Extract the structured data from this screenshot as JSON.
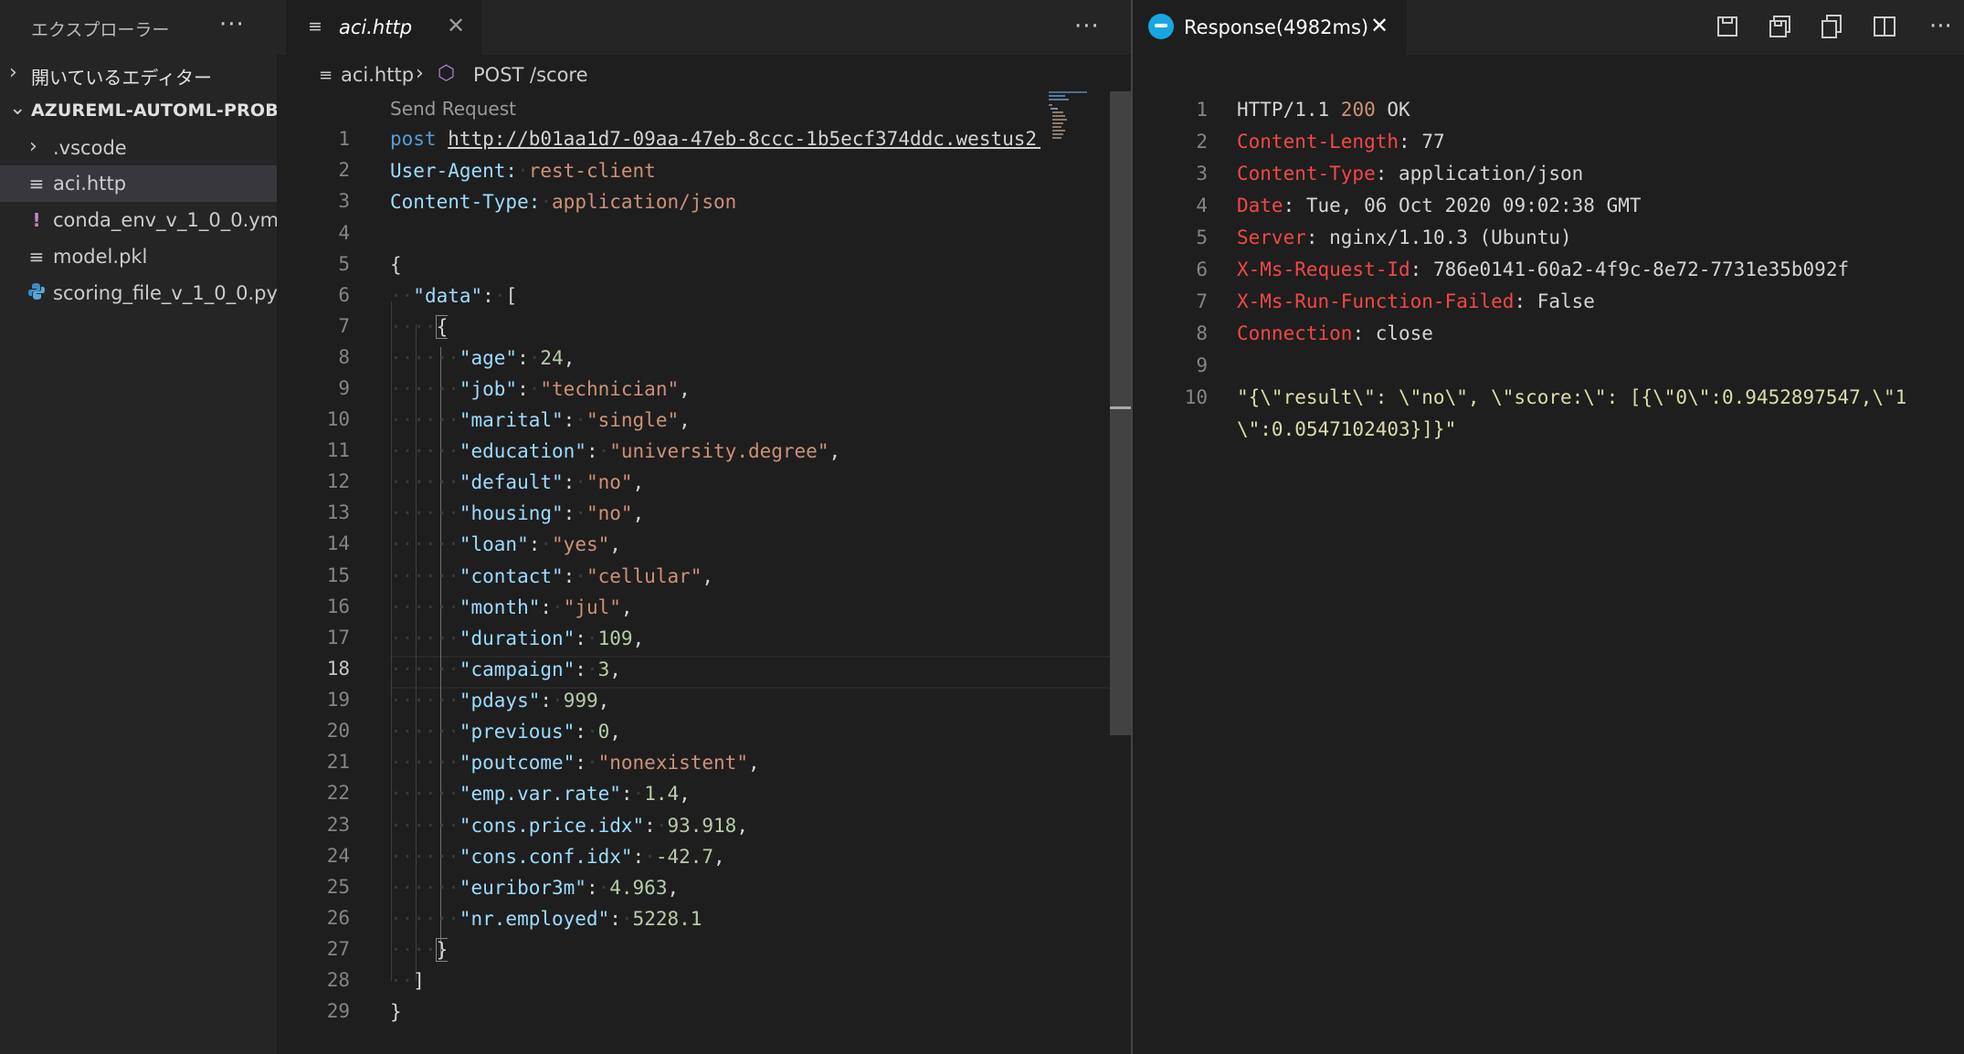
{
  "sidebar": {
    "title": "エクスプローラー",
    "more": "···",
    "open_editors": "開いているエディター",
    "project": "AZUREML-AUTOML-PROB...",
    "items": [
      {
        "label": ".vscode",
        "icon": "chevron-right-icon"
      },
      {
        "label": "aci.http",
        "icon": "file-lines-icon"
      },
      {
        "label": "conda_env_v_1_0_0.yml",
        "icon": "exclamation-icon"
      },
      {
        "label": "model.pkl",
        "icon": "file-lines-icon"
      },
      {
        "label": "scoring_file_v_1_0_0.py",
        "icon": "python-icon"
      }
    ]
  },
  "editor": {
    "tab": {
      "label": "aci.http",
      "close": "✕"
    },
    "more": "···",
    "breadcrumb": {
      "file": "aci.http",
      "separator": "›",
      "symbol": "POST /score"
    },
    "codelens": "Send Request",
    "line_numbers": [
      "1",
      "2",
      "3",
      "4",
      "5",
      "6",
      "7",
      "8",
      "9",
      "10",
      "11",
      "12",
      "13",
      "14",
      "15",
      "16",
      "17",
      "18",
      "19",
      "20",
      "21",
      "22",
      "23",
      "24",
      "25",
      "26",
      "27",
      "28",
      "29"
    ]
  },
  "response": {
    "tab": {
      "label": "Response(4982ms)",
      "close": "✕"
    },
    "actions": [
      "save-icon",
      "save-body-icon",
      "copy-icon",
      "split-editor-icon",
      "more-icon"
    ],
    "more": "···",
    "line_numbers": [
      "1",
      "2",
      "3",
      "4",
      "5",
      "6",
      "7",
      "8",
      "9",
      "10"
    ],
    "status_line": {
      "proto": "HTTP/1.1 ",
      "code": "200",
      "text": " OK"
    },
    "headers": [
      {
        "name": "Content-Length",
        "value": "77"
      },
      {
        "name": "Content-Type",
        "value": "application/json"
      },
      {
        "name": "Date",
        "value": "Tue, 06 Oct 2020 09:02:38 GMT"
      },
      {
        "name": "Server",
        "value": "nginx/1.10.3 (Ubuntu)"
      },
      {
        "name": "X-Ms-Request-Id",
        "value": "786e0141-60a2-4f9c-8e72-7731e35b092f"
      },
      {
        "name": "X-Ms-Run-Function-Failed",
        "value": "False"
      },
      {
        "name": "Connection",
        "value": "close"
      }
    ],
    "body_line1": "\"{\\\"result\\\": \\\"no\\\", \\\"score:\\\": [{\\\"0\\\":0.9452897547,\\\"1",
    "body_line2": "\\\":0.0547102403}]}\""
  },
  "colors": {
    "background": "#1e1e1e",
    "sidebar": "#252526",
    "selected_item": "#37373d",
    "keyword": "#569cd6",
    "property": "#9cdcfe",
    "string": "#ce9178",
    "number": "#b5cea8",
    "header_name": "#f44747",
    "response_body": "#dcdcaa",
    "rest_client_icon": "#17a7e0"
  }
}
